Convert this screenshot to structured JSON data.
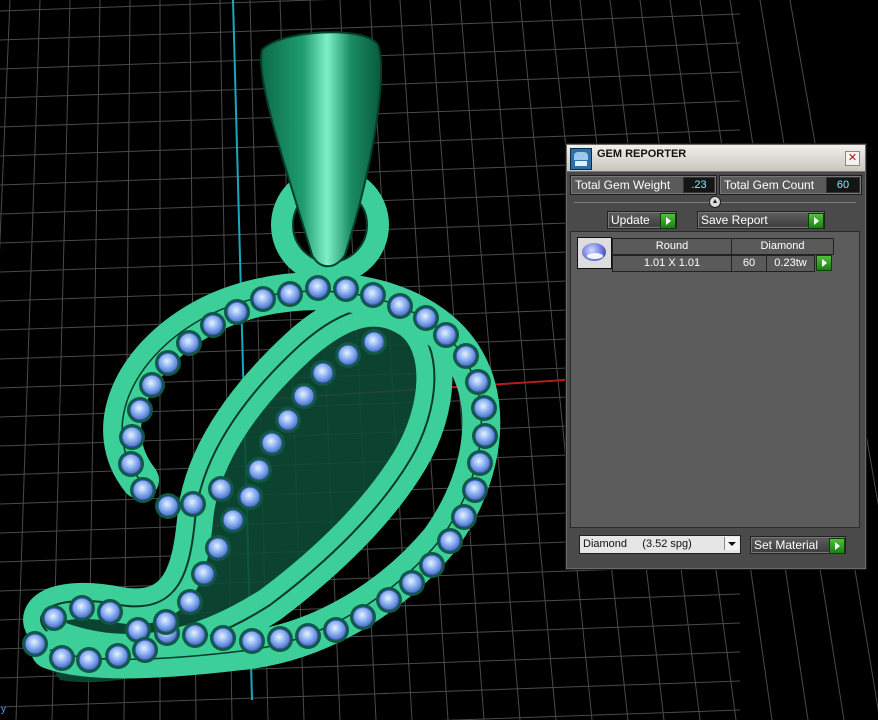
{
  "viewport": {
    "axis_colors": {
      "grid": "#5a5a5a",
      "y_axis": "#19a8bd",
      "x_axis": "#c02020"
    },
    "model_color": "#3ccf9a",
    "gem_color": "#7ea8f0",
    "corner_label": "y"
  },
  "gem_reporter": {
    "title": "GEM REPORTER",
    "close_icon": "close-icon",
    "total_gem_weight_label": "Total Gem Weight",
    "total_gem_weight_value": ".23",
    "total_gem_count_label": "Total Gem Count",
    "total_gem_count_value": "60",
    "update_label": "Update",
    "save_report_label": "Save Report",
    "table": {
      "shape": "Round",
      "material": "Diamond",
      "size": "1.01 X 1.01",
      "count": "60",
      "weight": "0.23tw"
    },
    "material_select_value": "Diamond     (3.52 spg)",
    "set_material_label": "Set Material"
  }
}
